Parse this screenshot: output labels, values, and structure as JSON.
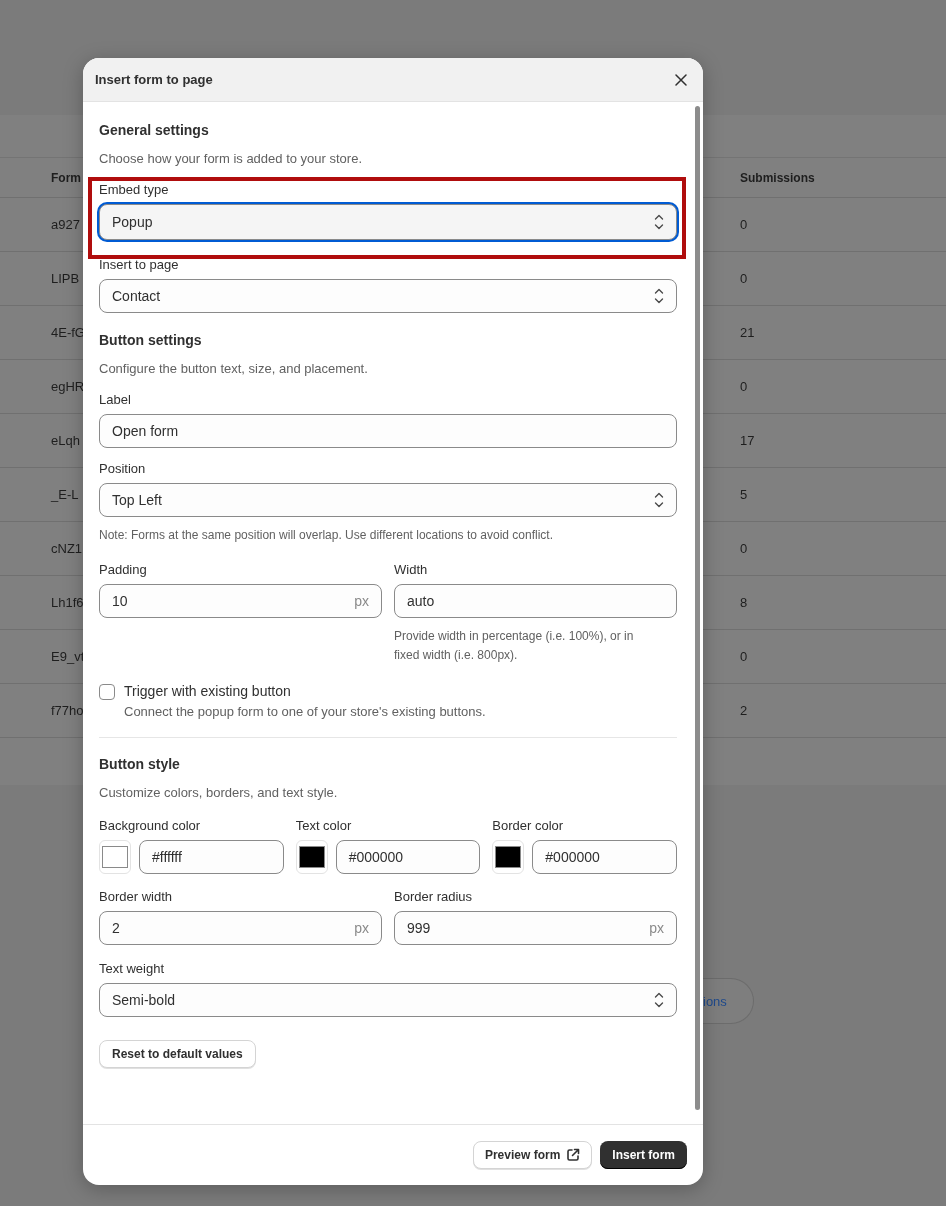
{
  "background_page": {
    "table": {
      "columns": [
        "Form",
        "Submissions"
      ],
      "rows": [
        {
          "form_id": "a927",
          "submissions": "0"
        },
        {
          "form_id": "LIPB",
          "submissions": "0"
        },
        {
          "form_id": "4E-fG",
          "submissions": "21"
        },
        {
          "form_id": "egHR",
          "submissions": "0"
        },
        {
          "form_id": "eLqh",
          "submissions": "17"
        },
        {
          "form_id": "_E-L",
          "submissions": "5"
        },
        {
          "form_id": "cNZ1",
          "submissions": "0"
        },
        {
          "form_id": "Lh1f6",
          "submissions": "8"
        },
        {
          "form_id": "E9_vt",
          "submissions": "0"
        },
        {
          "form_id": "f77ho",
          "submissions": "2"
        }
      ]
    },
    "action_button": {
      "label": "ions"
    }
  },
  "dialog": {
    "title": "Insert form to page",
    "general_settings": {
      "heading": "General settings",
      "description": "Choose how your form is added to your store.",
      "embed_type": {
        "label": "Embed type",
        "value": "Popup",
        "focused": true,
        "highlighted": true
      },
      "insert_to_page": {
        "label": "Insert to page",
        "value": "Contact"
      }
    },
    "button_settings": {
      "heading": "Button settings",
      "description": "Configure the button text, size, and placement.",
      "label_field": {
        "label": "Label",
        "value": "Open form"
      },
      "position": {
        "label": "Position",
        "value": "Top Left",
        "note": "Note: Forms at the same position will overlap. Use different locations to avoid conflict."
      },
      "padding": {
        "label": "Padding",
        "value": "10",
        "unit": "px"
      },
      "width": {
        "label": "Width",
        "value": "auto",
        "help": "Provide width in percentage (i.e. 100%), or in fixed width (i.e. 800px)."
      },
      "trigger": {
        "label": "Trigger with existing button",
        "description": "Connect the popup form to one of your store's existing buttons.",
        "checked": false
      }
    },
    "button_style": {
      "heading": "Button style",
      "description": "Customize colors, borders, and text style.",
      "colors": [
        {
          "label": "Background color",
          "value": "#ffffff",
          "color": "#ffffff"
        },
        {
          "label": "Text color",
          "value": "#000000",
          "color": "#000000"
        },
        {
          "label": "Border color",
          "value": "#000000",
          "color": "#000000"
        }
      ],
      "border_width": {
        "label": "Border width",
        "value": "2",
        "unit": "px"
      },
      "border_radius": {
        "label": "Border radius",
        "value": "999",
        "unit": "px"
      },
      "text_weight": {
        "label": "Text weight",
        "value": "Semi-bold"
      },
      "reset_button": "Reset to default values"
    },
    "footer": {
      "preview_button": "Preview form",
      "insert_button": "Insert form"
    }
  }
}
